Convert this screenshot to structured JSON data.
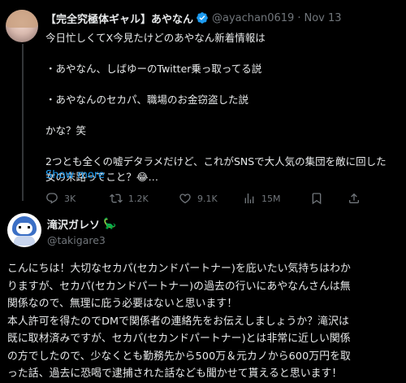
{
  "tweet": {
    "author_name": "【完全究極体ギャル】あやなん",
    "handle": "@ayachan0619",
    "separator": "·",
    "date": "Nov 13",
    "lines": [
      "今日忙しくてX今見たけどのあやなん新着情報は",
      "",
      "・あやなん、しばゆーのTwitter乗っ取ってる説",
      "",
      "・あやなんのセカパ、職場のお金窃盗した説",
      "",
      "かな？笑",
      "",
      "2つとも全くの嘘デタラメだけど、これがSNSで大人気の集団を敵に回した",
      "女の末路ってこと？😂…"
    ],
    "show_more": "Show more",
    "actions": {
      "replies": "3K",
      "retweets": "1.2K",
      "likes": "9.1K",
      "views": "15M"
    }
  },
  "reply": {
    "author_name": "滝沢ガレソ",
    "emoji": "🦕",
    "handle": "@takigare3",
    "lines": [
      "こんにちは！大切なセカパ(セカンドパートナー)を庇いたい気持ちはわか",
      "りますが、セカパ(セカンドパートナー)の過去の行いにあやなんさんは無",
      "関係なので、無理に庇う必要はないと思います！",
      "本人許可を得たのでDMで関係者の連絡先をお伝えしましょうか？滝沢は",
      "既に取材済みですが、セカパ(セカンドパートナー)とは非常に近しい関係",
      "の方でしたので、少なくとも勤務先から500万＆元カノから600万円を取",
      "った話、過去に恐喝で逮捕された話なども聞かせて貰えると思います！"
    ]
  },
  "colors": {
    "background": "#000000",
    "text": "#e7e9ea",
    "secondary": "#71767b",
    "link": "#1d9bf0",
    "verified": "#1d9bf0"
  },
  "icons": [
    "reply-icon",
    "retweet-icon",
    "like-icon",
    "views-icon",
    "bookmark-icon",
    "share-icon",
    "verified-icon"
  ]
}
